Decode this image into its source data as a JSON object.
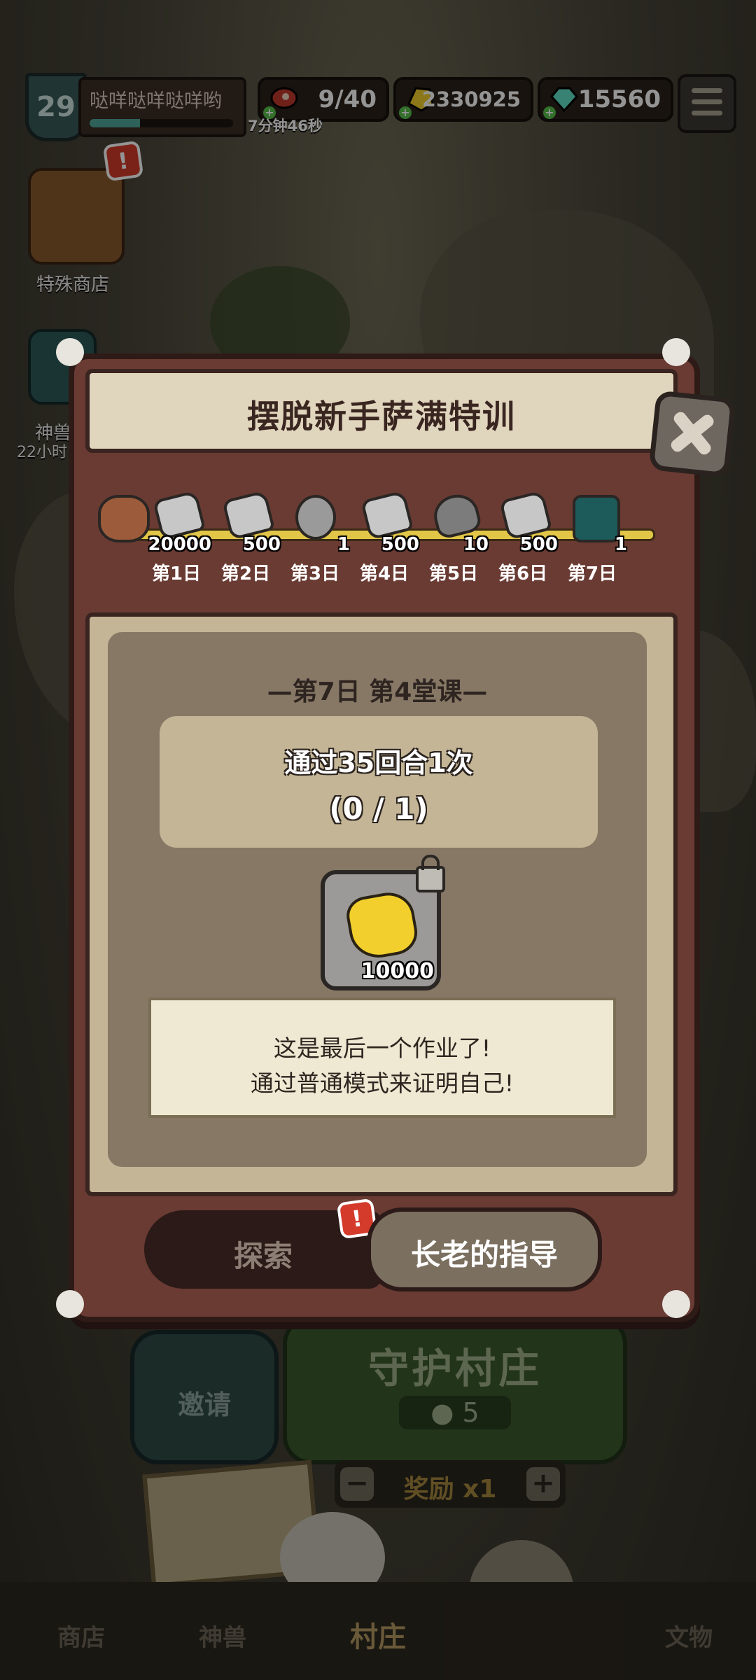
{
  "hud": {
    "level": "29",
    "player_name": "哒咩哒咩哒咩哟",
    "xp_fraction": 0.35,
    "meat": "9/40",
    "meat_timer": "7分钟46秒",
    "gold": "2330925",
    "gems": "15560"
  },
  "side": {
    "special_shop_label": "特殊商店",
    "beast_label_line1": "神兽",
    "beast_label_line2": "22小时"
  },
  "modal": {
    "title": "摆脱新手萨满特训",
    "days": [
      {
        "label": "第1日",
        "amount": "20000",
        "icon": "stone-icon"
      },
      {
        "label": "第2日",
        "amount": "500",
        "icon": "stone-icon"
      },
      {
        "label": "第3日",
        "amount": "1",
        "icon": "medal-icon"
      },
      {
        "label": "第4日",
        "amount": "500",
        "icon": "stone-icon"
      },
      {
        "label": "第5日",
        "amount": "10",
        "icon": "fang-stone-icon"
      },
      {
        "label": "第6日",
        "amount": "500",
        "icon": "stone-icon"
      },
      {
        "label": "第7日",
        "amount": "1",
        "icon": "paw-totem-icon"
      }
    ],
    "lesson_header": "—第7日 第4堂课—",
    "task_text": "通过35回合1次",
    "task_progress": "(0 / 1)",
    "reward_amount": "10000",
    "note_line1": "这是最后一个作业了!",
    "note_line2": "通过普通模式来证明自己!",
    "explore_label": "探索",
    "elder_label": "长老的指导",
    "alert_mark": "!"
  },
  "background": {
    "village_button": "守护村庄",
    "village_cost": "5",
    "invite_label": "邀请",
    "reward_multiplier": "奖励 x1",
    "nav": [
      "商店",
      "神兽",
      "村庄",
      "文物"
    ]
  },
  "colors": {
    "modal_frame": "#6a3b33",
    "paper": "#c3b595",
    "gold": "#f2cf2c",
    "track": "#e2c648"
  }
}
